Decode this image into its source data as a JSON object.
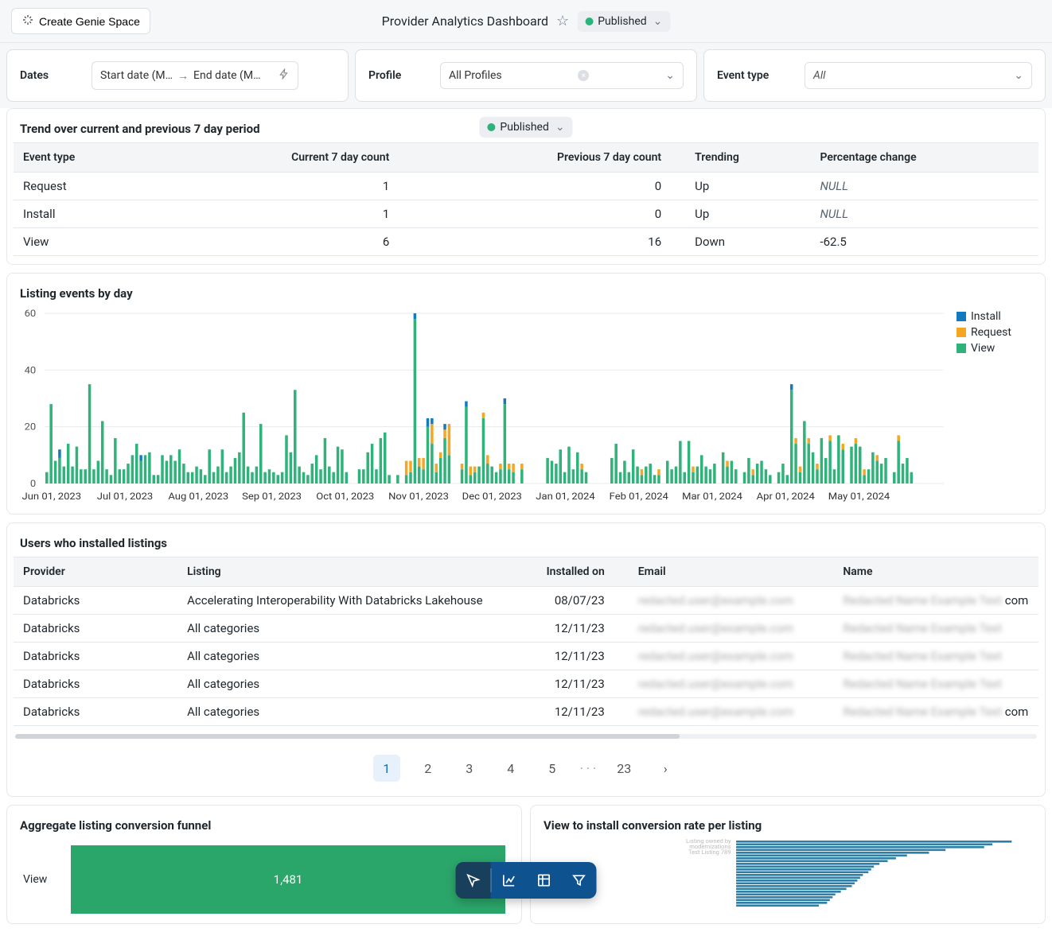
{
  "header": {
    "genie_button": "Create Genie Space",
    "title": "Provider Analytics Dashboard",
    "publish_state": "Published"
  },
  "filters": {
    "dates_label": "Dates",
    "date_start_placeholder": "Start date (M…",
    "date_end_placeholder": "End date (M…",
    "profile_label": "Profile",
    "profile_value": "All Profiles",
    "event_type_label": "Event type",
    "event_type_value": "All"
  },
  "trend_panel": {
    "title": "Trend over current and previous 7 day period",
    "chip_label": "Published",
    "columns": [
      "Event type",
      "Current 7 day count",
      "Previous 7 day count",
      "Trending",
      "Percentage change"
    ],
    "rows": [
      {
        "event": "Request",
        "cur": "1",
        "prev": "0",
        "trend": "Up",
        "pct": "NULL"
      },
      {
        "event": "Install",
        "cur": "1",
        "prev": "0",
        "trend": "Up",
        "pct": "NULL"
      },
      {
        "event": "View",
        "cur": "6",
        "prev": "16",
        "trend": "Down",
        "pct": "-62.5"
      }
    ]
  },
  "events_chart": {
    "title": "Listing events by day",
    "legend": {
      "install": "Install",
      "request": "Request",
      "view": "View"
    },
    "colors": {
      "install": "#137bbd",
      "request": "#f5a623",
      "view": "#2fb37a"
    }
  },
  "chart_data": {
    "type": "bar",
    "stacked": true,
    "title": "Listing events by day",
    "xlabel": "",
    "ylabel": "",
    "ylim": [
      0,
      60
    ],
    "y_ticks": [
      0,
      20,
      40,
      60
    ],
    "x_ticks": [
      "Jun 01, 2023",
      "Jul 01, 2023",
      "Aug 01, 2023",
      "Sep 01, 2023",
      "Oct 01, 2023",
      "Nov 01, 2023",
      "Dec 01, 2023",
      "Jan 01, 2024",
      "Feb 01, 2024",
      "Mar 01, 2024",
      "Apr 01, 2024",
      "May 01, 2024"
    ],
    "series": [
      {
        "name": "View",
        "color": "#2fb37a",
        "values": [
          4,
          28,
          8,
          9,
          6,
          14,
          6,
          13,
          5,
          5,
          35,
          5,
          8,
          22,
          5,
          3,
          16,
          5,
          5,
          7,
          10,
          14,
          8,
          10,
          11,
          3,
          3,
          10,
          8,
          10,
          8,
          12,
          7,
          4,
          4,
          6,
          5,
          3,
          12,
          4,
          6,
          12,
          4,
          6,
          9,
          11,
          25,
          6,
          4,
          6,
          21,
          4,
          5,
          4,
          3,
          4,
          17,
          11,
          33,
          6,
          4,
          3,
          7,
          10,
          5,
          16,
          6,
          4,
          13,
          12,
          4,
          0,
          0,
          5,
          5,
          11,
          14,
          5,
          16,
          18,
          3,
          0,
          3,
          0,
          3,
          4,
          58,
          6,
          5,
          20,
          14,
          4,
          9,
          16,
          10,
          0,
          0,
          5,
          27,
          3,
          4,
          6,
          23,
          7,
          6,
          4,
          5,
          28,
          5,
          4,
          0,
          5,
          0,
          0,
          0,
          0,
          0,
          9,
          8,
          7,
          12,
          4,
          13,
          5,
          11,
          5,
          4,
          0,
          0,
          0,
          0,
          0,
          9,
          14,
          4,
          8,
          4,
          12,
          6,
          3,
          6,
          7,
          3,
          3,
          0,
          8,
          5,
          6,
          15,
          4,
          15,
          4,
          6,
          10,
          6,
          5,
          7,
          0,
          11,
          6,
          8,
          5,
          0,
          4,
          9,
          3,
          7,
          8,
          5,
          3,
          0,
          4,
          7,
          3,
          33,
          14,
          4,
          22,
          14,
          11,
          5,
          16,
          9,
          15,
          5,
          17,
          12,
          0,
          13,
          14,
          13,
          3,
          5,
          11,
          8,
          7,
          9,
          0,
          4,
          15,
          7,
          9,
          4,
          0,
          0,
          0,
          0,
          0,
          0,
          0
        ]
      },
      {
        "name": "Request",
        "color": "#f5a623",
        "values": [
          0,
          0,
          0,
          0,
          0,
          0,
          0,
          0,
          0,
          0,
          0,
          0,
          0,
          0,
          0,
          0,
          0,
          0,
          0,
          0,
          0,
          0,
          0,
          0,
          0,
          0,
          0,
          0,
          0,
          0,
          0,
          0,
          0,
          0,
          0,
          0,
          0,
          0,
          0,
          0,
          0,
          0,
          0,
          0,
          0,
          0,
          0,
          0,
          0,
          0,
          0,
          0,
          0,
          0,
          0,
          0,
          0,
          0,
          0,
          0,
          0,
          0,
          0,
          0,
          0,
          0,
          0,
          0,
          0,
          0,
          0,
          0,
          0,
          0,
          0,
          0,
          0,
          0,
          0,
          0,
          0,
          0,
          0,
          0,
          5,
          4,
          0,
          3,
          4,
          0,
          7,
          3,
          2,
          3,
          11,
          0,
          0,
          2,
          0,
          3,
          2,
          0,
          2,
          3,
          0,
          0,
          2,
          0,
          2,
          3,
          0,
          2,
          0,
          0,
          0,
          0,
          0,
          0,
          0,
          0,
          0,
          0,
          0,
          0,
          0,
          2,
          0,
          0,
          0,
          0,
          0,
          0,
          0,
          0,
          0,
          0,
          0,
          0,
          0,
          2,
          0,
          0,
          0,
          2,
          0,
          0,
          0,
          0,
          0,
          0,
          0,
          2,
          0,
          0,
          0,
          0,
          0,
          0,
          0,
          2,
          0,
          0,
          0,
          0,
          0,
          2,
          0,
          0,
          0,
          0,
          0,
          0,
          0,
          0,
          0,
          2,
          2,
          0,
          2,
          0,
          2,
          0,
          0,
          2,
          0,
          0,
          2,
          0,
          0,
          2,
          0,
          2,
          0,
          0,
          2,
          0,
          0,
          0,
          0,
          2,
          0,
          0,
          0,
          0,
          0,
          0,
          0,
          0,
          0,
          0
        ]
      },
      {
        "name": "Install",
        "color": "#137bbd",
        "values": [
          0,
          0,
          0,
          3,
          0,
          0,
          0,
          0,
          0,
          0,
          0,
          0,
          0,
          0,
          0,
          0,
          0,
          0,
          0,
          0,
          0,
          0,
          2,
          0,
          0,
          0,
          0,
          0,
          0,
          0,
          0,
          0,
          0,
          0,
          0,
          0,
          0,
          0,
          0,
          0,
          0,
          0,
          0,
          0,
          0,
          0,
          0,
          0,
          0,
          0,
          0,
          0,
          0,
          0,
          0,
          0,
          0,
          0,
          0,
          0,
          0,
          0,
          0,
          0,
          0,
          0,
          0,
          0,
          0,
          0,
          0,
          0,
          0,
          0,
          0,
          0,
          0,
          0,
          0,
          0,
          0,
          0,
          0,
          0,
          0,
          0,
          2,
          0,
          0,
          3,
          2,
          0,
          0,
          2,
          0,
          0,
          0,
          0,
          2,
          0,
          0,
          0,
          0,
          0,
          0,
          0,
          0,
          2,
          0,
          0,
          0,
          0,
          0,
          0,
          0,
          0,
          0,
          0,
          0,
          0,
          0,
          0,
          0,
          0,
          0,
          0,
          0,
          0,
          0,
          0,
          0,
          0,
          0,
          0,
          0,
          0,
          0,
          0,
          0,
          0,
          0,
          0,
          0,
          0,
          0,
          0,
          0,
          0,
          0,
          0,
          0,
          0,
          0,
          0,
          0,
          0,
          0,
          0,
          0,
          0,
          0,
          0,
          0,
          0,
          0,
          0,
          0,
          0,
          0,
          0,
          0,
          0,
          0,
          0,
          2,
          0,
          0,
          0,
          0,
          0,
          0,
          0,
          0,
          0,
          0,
          0,
          0,
          0,
          0,
          0,
          0,
          0,
          0,
          0,
          0,
          0,
          0,
          0,
          0,
          0,
          0,
          0,
          0,
          0,
          0,
          0,
          0,
          0,
          0,
          0
        ]
      }
    ]
  },
  "install_panel": {
    "title": "Users who installed listings",
    "columns": [
      "Provider",
      "Listing",
      "Installed on",
      "Email",
      "Name"
    ],
    "rows": [
      {
        "provider": "Databricks",
        "listing": "Accelerating Interoperability With Databricks Lakehouse",
        "date": "08/07/23",
        "name_suffix": "com"
      },
      {
        "provider": "Databricks",
        "listing": "All categories",
        "date": "12/11/23",
        "name_suffix": ""
      },
      {
        "provider": "Databricks",
        "listing": "All categories",
        "date": "12/11/23",
        "name_suffix": ""
      },
      {
        "provider": "Databricks",
        "listing": "All categories",
        "date": "12/11/23",
        "name_suffix": ""
      },
      {
        "provider": "Databricks",
        "listing": "All categories",
        "date": "12/11/23",
        "name_suffix": "com"
      }
    ]
  },
  "pager": {
    "pages": [
      "1",
      "2",
      "3",
      "4",
      "5"
    ],
    "last": "23"
  },
  "funnel": {
    "title": "Aggregate listing conversion funnel",
    "row_label": "View",
    "row_value": "1,481"
  },
  "vtoi": {
    "title": "View to install conversion rate per listing"
  }
}
